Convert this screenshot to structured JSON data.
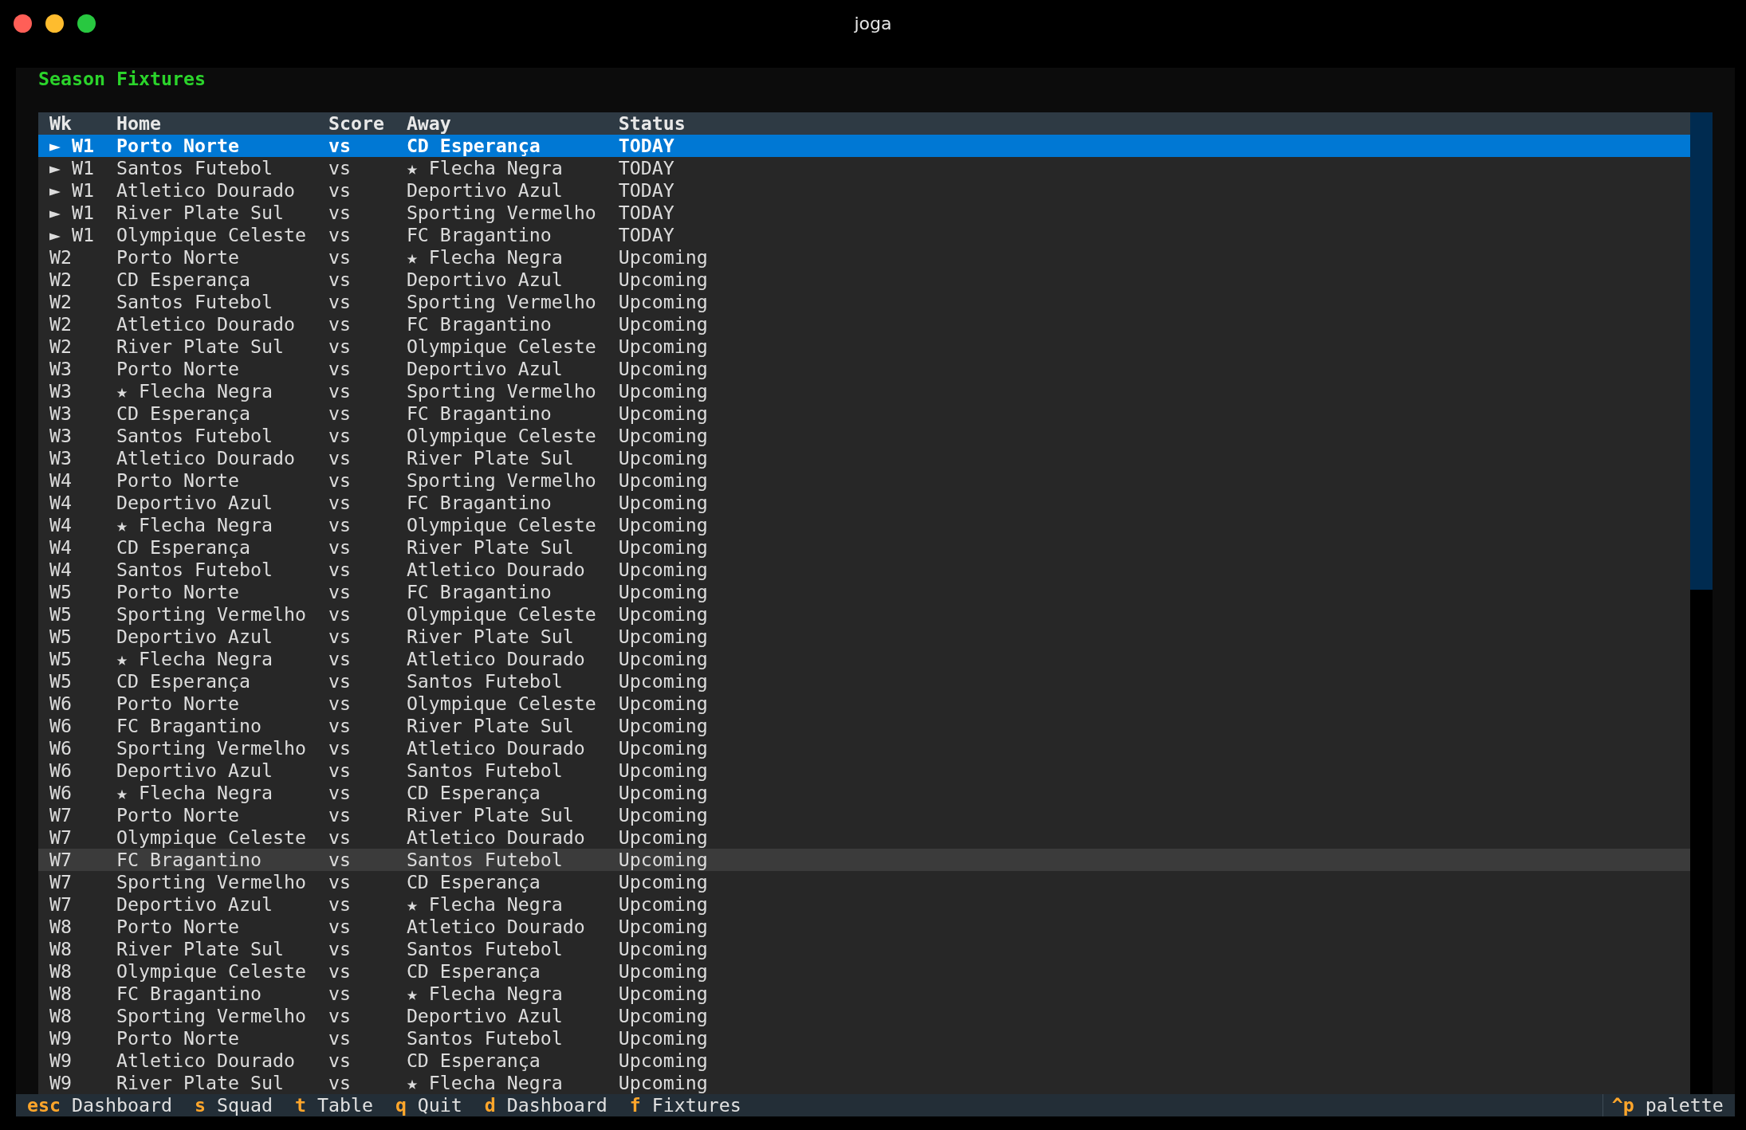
{
  "window": {
    "title": "joga"
  },
  "panel": {
    "title": "Season Fixtures"
  },
  "table": {
    "columns": [
      "Wk",
      "Home",
      "Score",
      "Away",
      "Status"
    ],
    "rows": [
      {
        "cells": [
          "► W1",
          "Porto Norte",
          "vs",
          "CD Esperança",
          "TODAY"
        ],
        "selected": true,
        "hovered": false
      },
      {
        "cells": [
          "► W1",
          "Santos Futebol",
          "vs",
          "★ Flecha Negra",
          "TODAY"
        ],
        "selected": false,
        "hovered": false
      },
      {
        "cells": [
          "► W1",
          "Atletico Dourado",
          "vs",
          "Deportivo Azul",
          "TODAY"
        ],
        "selected": false,
        "hovered": false
      },
      {
        "cells": [
          "► W1",
          "River Plate Sul",
          "vs",
          "Sporting Vermelho",
          "TODAY"
        ],
        "selected": false,
        "hovered": false
      },
      {
        "cells": [
          "► W1",
          "Olympique Celeste",
          "vs",
          "FC Bragantino",
          "TODAY"
        ],
        "selected": false,
        "hovered": false
      },
      {
        "cells": [
          "W2",
          "Porto Norte",
          "vs",
          "★ Flecha Negra",
          "Upcoming"
        ],
        "selected": false,
        "hovered": false
      },
      {
        "cells": [
          "W2",
          "CD Esperança",
          "vs",
          "Deportivo Azul",
          "Upcoming"
        ],
        "selected": false,
        "hovered": false
      },
      {
        "cells": [
          "W2",
          "Santos Futebol",
          "vs",
          "Sporting Vermelho",
          "Upcoming"
        ],
        "selected": false,
        "hovered": false
      },
      {
        "cells": [
          "W2",
          "Atletico Dourado",
          "vs",
          "FC Bragantino",
          "Upcoming"
        ],
        "selected": false,
        "hovered": false
      },
      {
        "cells": [
          "W2",
          "River Plate Sul",
          "vs",
          "Olympique Celeste",
          "Upcoming"
        ],
        "selected": false,
        "hovered": false
      },
      {
        "cells": [
          "W3",
          "Porto Norte",
          "vs",
          "Deportivo Azul",
          "Upcoming"
        ],
        "selected": false,
        "hovered": false
      },
      {
        "cells": [
          "W3",
          "★ Flecha Negra",
          "vs",
          "Sporting Vermelho",
          "Upcoming"
        ],
        "selected": false,
        "hovered": false
      },
      {
        "cells": [
          "W3",
          "CD Esperança",
          "vs",
          "FC Bragantino",
          "Upcoming"
        ],
        "selected": false,
        "hovered": false
      },
      {
        "cells": [
          "W3",
          "Santos Futebol",
          "vs",
          "Olympique Celeste",
          "Upcoming"
        ],
        "selected": false,
        "hovered": false
      },
      {
        "cells": [
          "W3",
          "Atletico Dourado",
          "vs",
          "River Plate Sul",
          "Upcoming"
        ],
        "selected": false,
        "hovered": false
      },
      {
        "cells": [
          "W4",
          "Porto Norte",
          "vs",
          "Sporting Vermelho",
          "Upcoming"
        ],
        "selected": false,
        "hovered": false
      },
      {
        "cells": [
          "W4",
          "Deportivo Azul",
          "vs",
          "FC Bragantino",
          "Upcoming"
        ],
        "selected": false,
        "hovered": false
      },
      {
        "cells": [
          "W4",
          "★ Flecha Negra",
          "vs",
          "Olympique Celeste",
          "Upcoming"
        ],
        "selected": false,
        "hovered": false
      },
      {
        "cells": [
          "W4",
          "CD Esperança",
          "vs",
          "River Plate Sul",
          "Upcoming"
        ],
        "selected": false,
        "hovered": false
      },
      {
        "cells": [
          "W4",
          "Santos Futebol",
          "vs",
          "Atletico Dourado",
          "Upcoming"
        ],
        "selected": false,
        "hovered": false
      },
      {
        "cells": [
          "W5",
          "Porto Norte",
          "vs",
          "FC Bragantino",
          "Upcoming"
        ],
        "selected": false,
        "hovered": false
      },
      {
        "cells": [
          "W5",
          "Sporting Vermelho",
          "vs",
          "Olympique Celeste",
          "Upcoming"
        ],
        "selected": false,
        "hovered": false
      },
      {
        "cells": [
          "W5",
          "Deportivo Azul",
          "vs",
          "River Plate Sul",
          "Upcoming"
        ],
        "selected": false,
        "hovered": false
      },
      {
        "cells": [
          "W5",
          "★ Flecha Negra",
          "vs",
          "Atletico Dourado",
          "Upcoming"
        ],
        "selected": false,
        "hovered": false
      },
      {
        "cells": [
          "W5",
          "CD Esperança",
          "vs",
          "Santos Futebol",
          "Upcoming"
        ],
        "selected": false,
        "hovered": false
      },
      {
        "cells": [
          "W6",
          "Porto Norte",
          "vs",
          "Olympique Celeste",
          "Upcoming"
        ],
        "selected": false,
        "hovered": false
      },
      {
        "cells": [
          "W6",
          "FC Bragantino",
          "vs",
          "River Plate Sul",
          "Upcoming"
        ],
        "selected": false,
        "hovered": false
      },
      {
        "cells": [
          "W6",
          "Sporting Vermelho",
          "vs",
          "Atletico Dourado",
          "Upcoming"
        ],
        "selected": false,
        "hovered": false
      },
      {
        "cells": [
          "W6",
          "Deportivo Azul",
          "vs",
          "Santos Futebol",
          "Upcoming"
        ],
        "selected": false,
        "hovered": false
      },
      {
        "cells": [
          "W6",
          "★ Flecha Negra",
          "vs",
          "CD Esperança",
          "Upcoming"
        ],
        "selected": false,
        "hovered": false
      },
      {
        "cells": [
          "W7",
          "Porto Norte",
          "vs",
          "River Plate Sul",
          "Upcoming"
        ],
        "selected": false,
        "hovered": false
      },
      {
        "cells": [
          "W7",
          "Olympique Celeste",
          "vs",
          "Atletico Dourado",
          "Upcoming"
        ],
        "selected": false,
        "hovered": false
      },
      {
        "cells": [
          "W7",
          "FC Bragantino",
          "vs",
          "Santos Futebol",
          "Upcoming"
        ],
        "selected": false,
        "hovered": true
      },
      {
        "cells": [
          "W7",
          "Sporting Vermelho",
          "vs",
          "CD Esperança",
          "Upcoming"
        ],
        "selected": false,
        "hovered": false
      },
      {
        "cells": [
          "W7",
          "Deportivo Azul",
          "vs",
          "★ Flecha Negra",
          "Upcoming"
        ],
        "selected": false,
        "hovered": false
      },
      {
        "cells": [
          "W8",
          "Porto Norte",
          "vs",
          "Atletico Dourado",
          "Upcoming"
        ],
        "selected": false,
        "hovered": false
      },
      {
        "cells": [
          "W8",
          "River Plate Sul",
          "vs",
          "Santos Futebol",
          "Upcoming"
        ],
        "selected": false,
        "hovered": false
      },
      {
        "cells": [
          "W8",
          "Olympique Celeste",
          "vs",
          "CD Esperança",
          "Upcoming"
        ],
        "selected": false,
        "hovered": false
      },
      {
        "cells": [
          "W8",
          "FC Bragantino",
          "vs",
          "★ Flecha Negra",
          "Upcoming"
        ],
        "selected": false,
        "hovered": false
      },
      {
        "cells": [
          "W8",
          "Sporting Vermelho",
          "vs",
          "Deportivo Azul",
          "Upcoming"
        ],
        "selected": false,
        "hovered": false
      },
      {
        "cells": [
          "W9",
          "Porto Norte",
          "vs",
          "Santos Futebol",
          "Upcoming"
        ],
        "selected": false,
        "hovered": false
      },
      {
        "cells": [
          "W9",
          "Atletico Dourado",
          "vs",
          "CD Esperança",
          "Upcoming"
        ],
        "selected": false,
        "hovered": false
      },
      {
        "cells": [
          "W9",
          "River Plate Sul",
          "vs",
          "★ Flecha Negra",
          "Upcoming"
        ],
        "selected": false,
        "hovered": false
      }
    ]
  },
  "footer": {
    "shortcuts": [
      {
        "key": "esc",
        "label": "Dashboard"
      },
      {
        "key": "s",
        "label": "Squad"
      },
      {
        "key": "t",
        "label": "Table"
      },
      {
        "key": "q",
        "label": "Quit"
      },
      {
        "key": "d",
        "label": "Dashboard"
      },
      {
        "key": "f",
        "label": "Fixtures"
      }
    ],
    "palette": {
      "key": "^p",
      "label": "palette"
    }
  }
}
